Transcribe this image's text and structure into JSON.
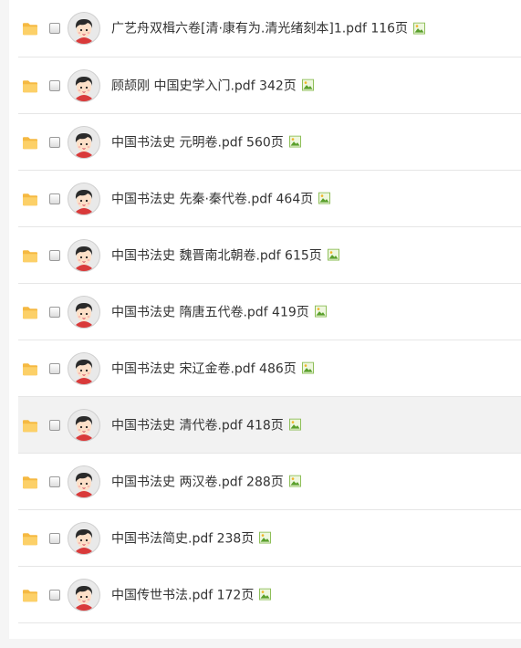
{
  "files": [
    {
      "name": "广艺舟双楫六卷[清·康有为.清光绪刻本]1.pdf 116页",
      "icon": "image-icon",
      "hover": false
    },
    {
      "name": "顾颉刚 中国史学入门.pdf 342页",
      "icon": "image-icon",
      "hover": false
    },
    {
      "name": "中国书法史 元明卷.pdf 560页",
      "icon": "image-icon",
      "hover": false
    },
    {
      "name": "中国书法史 先秦·秦代卷.pdf 464页",
      "icon": "image-icon",
      "hover": false
    },
    {
      "name": "中国书法史 魏晋南北朝卷.pdf 615页",
      "icon": "image-icon",
      "hover": false
    },
    {
      "name": "中国书法史 隋唐五代卷.pdf 419页",
      "icon": "image-icon",
      "hover": false
    },
    {
      "name": "中国书法史 宋辽金卷.pdf 486页",
      "icon": "image-icon",
      "hover": false
    },
    {
      "name": "中国书法史 清代卷.pdf 418页",
      "icon": "image-icon",
      "hover": true
    },
    {
      "name": "中国书法史 两汉卷.pdf 288页",
      "icon": "image-icon",
      "hover": false
    },
    {
      "name": "中国书法简史.pdf 238页",
      "icon": "image-icon",
      "hover": false
    },
    {
      "name": "中国传世书法.pdf 172页",
      "icon": "image-icon",
      "hover": false
    }
  ],
  "colors": {
    "folder": "#f5b942",
    "text": "#333333",
    "divider": "#e6e6e6",
    "hover_bg": "#f2f2f2"
  }
}
